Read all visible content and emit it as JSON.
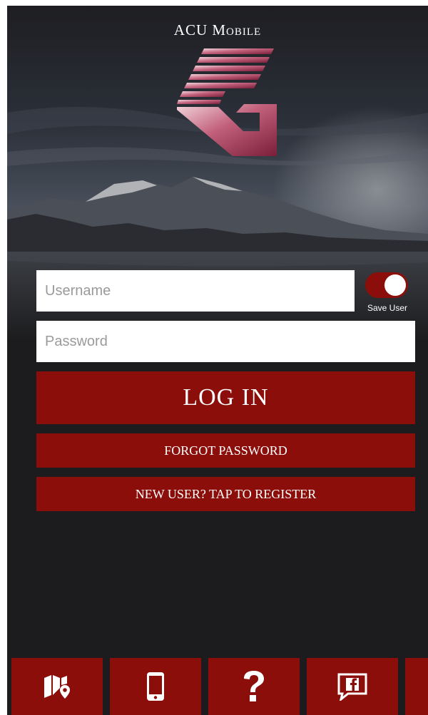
{
  "app": {
    "title": "ACU Mobile"
  },
  "login_form": {
    "username_placeholder": "Username",
    "password_placeholder": "Password",
    "save_user_label": "Save User",
    "save_user_enabled": true,
    "login_label": "LOG IN",
    "forgot_password_label": "FORGOT PASSWORD",
    "register_label": "NEW USER? TAP TO REGISTER"
  },
  "tabbar": {
    "items": [
      {
        "icon": "map-location-icon"
      },
      {
        "icon": "mobile-phone-icon"
      },
      {
        "icon": "question-mark-icon"
      },
      {
        "icon": "facebook-chat-icon"
      },
      {
        "icon": "more-tab"
      }
    ]
  },
  "colors": {
    "brand_red": "#8b0e0a",
    "background": "#1c1c1e",
    "logo_pink": "#b0445f"
  }
}
